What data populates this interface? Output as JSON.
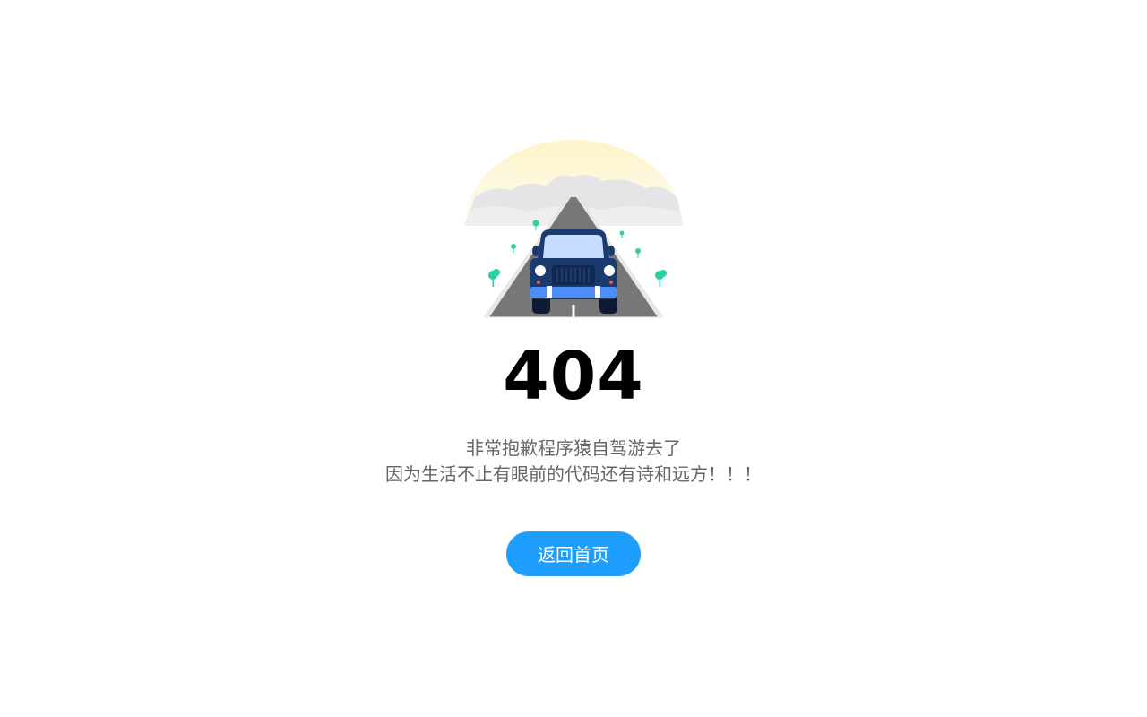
{
  "error": {
    "code": "404",
    "message_line1": "非常抱歉程序猿自驾游去了",
    "message_line2": "因为生活不止有眼前的代码还有诗和远方！！！"
  },
  "actions": {
    "home_button_label": "返回首页"
  },
  "illustration": {
    "icon": "car-on-road-icon"
  },
  "colors": {
    "button": "#1e9fff",
    "code_text": "#000000",
    "message_text": "#666666",
    "car_body": "#1b3a70",
    "tree": "#2fcfa3"
  }
}
